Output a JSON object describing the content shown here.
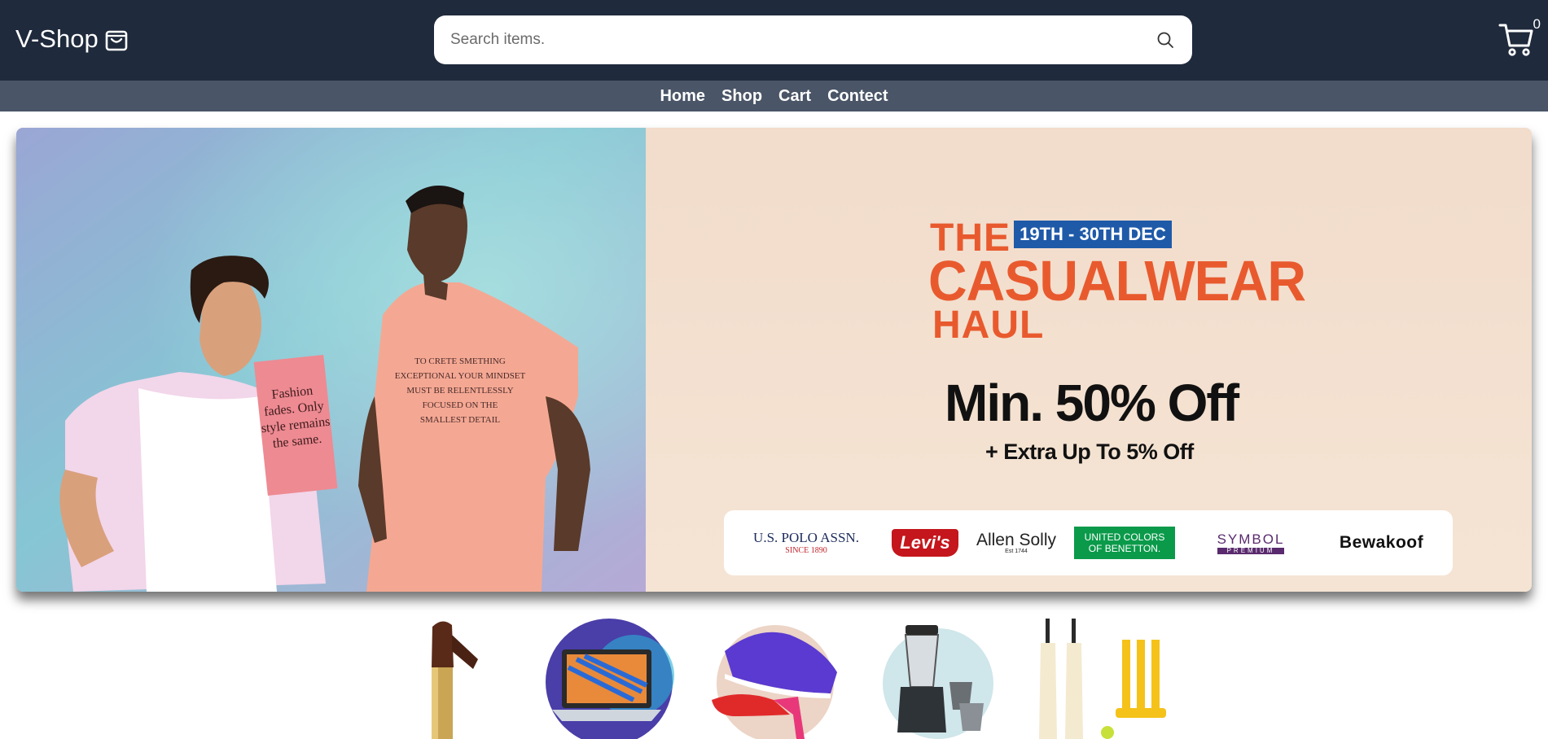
{
  "header": {
    "brand_name": "V-Shop",
    "brand_icon": "shopping-bag-icon",
    "search": {
      "placeholder": "Search items.",
      "value": "",
      "icon": "search-icon"
    },
    "cart": {
      "icon": "cart-icon",
      "count": "0"
    }
  },
  "nav": {
    "items": [
      {
        "label": "Home"
      },
      {
        "label": "Shop"
      },
      {
        "label": "Cart"
      },
      {
        "label": "Contect"
      }
    ]
  },
  "hero": {
    "title_the": "THE",
    "date_badge": "19TH - 30TH DEC",
    "title_main": "CASUALWEAR",
    "title_haul": "HAUL",
    "offer": "Min. 50% Off",
    "extra_offer": "+ Extra Up To 5% Off",
    "shirt_print_left": "Fashion fades. Only style remains the same.",
    "brands": [
      {
        "name": "U.S. POLO ASSN.",
        "sub": "SINCE 1890"
      },
      {
        "name": "Levi's"
      },
      {
        "name": "Allen Solly",
        "sub": "Est 1744"
      },
      {
        "name": "UNITED COLORS OF BENETTON."
      },
      {
        "name": "SYMBOL",
        "sub": "PREMIUM"
      },
      {
        "name": "Bewakoof"
      }
    ]
  },
  "categories": [
    {
      "name": "lipstick"
    },
    {
      "name": "laptop"
    },
    {
      "name": "footwear"
    },
    {
      "name": "mixer-grinder"
    },
    {
      "name": "cricket-set"
    }
  ],
  "colors": {
    "header_bg": "#1f2a3c",
    "nav_bg": "#4a5567",
    "hero_accent": "#e85a2e",
    "date_badge_bg": "#1f5aa8"
  }
}
